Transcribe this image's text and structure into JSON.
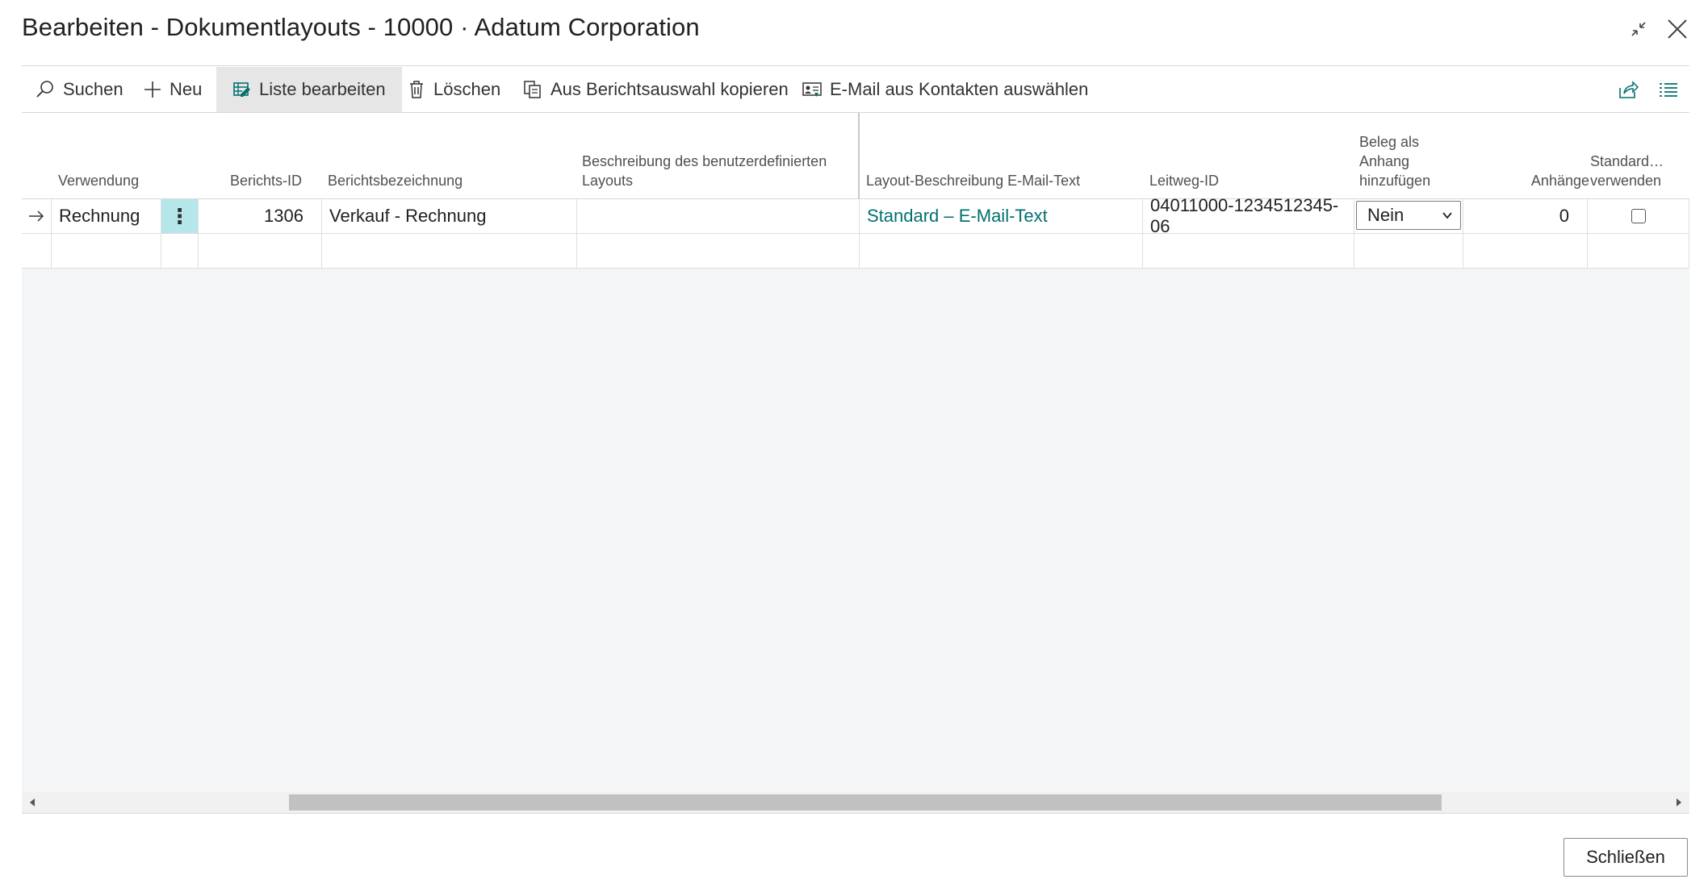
{
  "window": {
    "title": "Bearbeiten - Dokumentlayouts - 10000 · Adatum Corporation"
  },
  "toolbar": {
    "search": "Suchen",
    "new": "Neu",
    "edit_list": "Liste bearbeiten",
    "delete": "Löschen",
    "copy_from_report_selection": "Aus Berichtsauswahl kopieren",
    "email_from_contacts": "E-Mail aus Kontakten auswählen"
  },
  "table": {
    "headers": {
      "usage": "Verwendung",
      "report_id": "Berichts-ID",
      "report_name": "Berichtsbezeichnung",
      "custom_layout_desc": "Beschreibung des benutzerdefinierten Layouts",
      "email_body_layout_desc": "Layout-Beschreibung E-Mail-Text",
      "routing_id": "Leitweg-ID",
      "attach_doc": "Beleg als Anhang hinzufügen",
      "attachments": "Anhänge",
      "use_default": "Standard… verwenden"
    },
    "rows": [
      {
        "usage": "Rechnung",
        "report_id": "1306",
        "report_name": "Verkauf - Rechnung",
        "custom_layout_desc": "",
        "email_body_layout_desc": "Standard – E-Mail-Text",
        "routing_id": "04011000-1234512345-06",
        "attach_doc": "Nein",
        "attachments": "0",
        "use_default": false
      }
    ]
  },
  "footer": {
    "close": "Schließen"
  },
  "colors": {
    "accent": "#00716f",
    "selected_cell": "#b5e7ea",
    "active_tool": "#e6e6e6"
  }
}
